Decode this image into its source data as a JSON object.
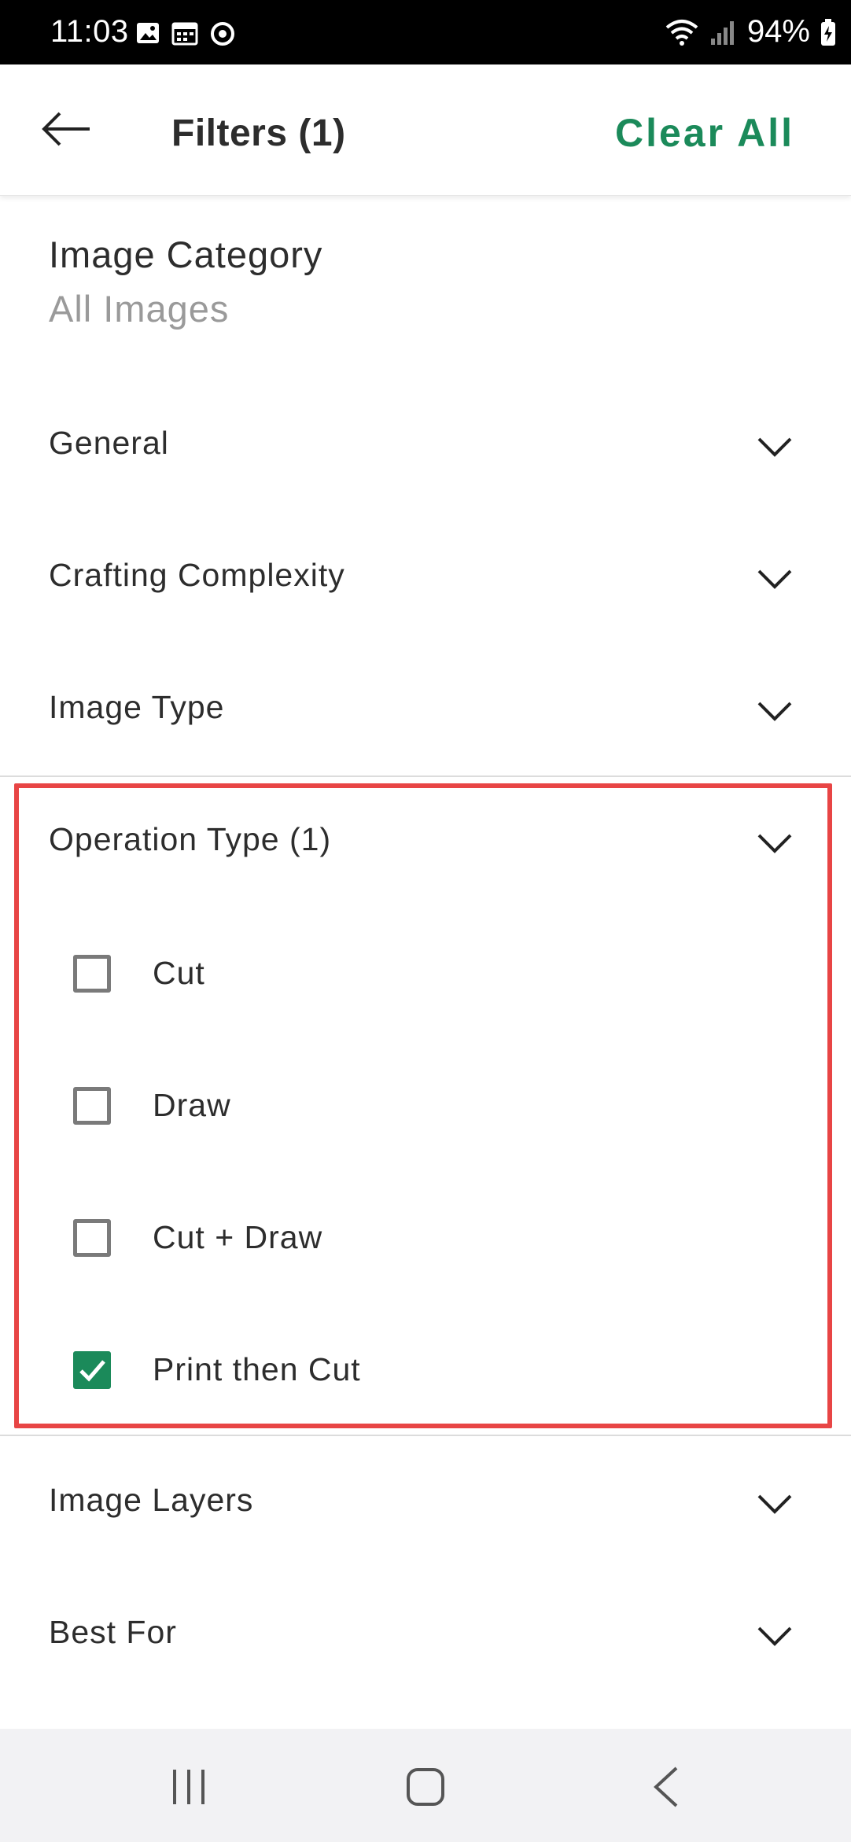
{
  "status_bar": {
    "time": "11:03",
    "battery": "94%",
    "left_icons": [
      "image-icon",
      "calendar-icon",
      "sync-icon"
    ],
    "right_icons": [
      "wifi-icon",
      "signal-icon",
      "battery-charging-icon"
    ]
  },
  "header": {
    "title": "Filters (1)",
    "clear_all": "Clear All",
    "accent_color": "#1b8a5a"
  },
  "image_category": {
    "label": "Image Category",
    "value": "All Images"
  },
  "sections": {
    "general": "General",
    "crafting_complexity": "Crafting Complexity",
    "image_type": "Image Type",
    "operation_type": "Operation Type (1)",
    "image_layers": "Image Layers",
    "best_for": "Best For"
  },
  "operation_options": [
    {
      "label": "Cut",
      "checked": false
    },
    {
      "label": "Draw",
      "checked": false
    },
    {
      "label": "Cut + Draw",
      "checked": false
    },
    {
      "label": "Print then Cut",
      "checked": true
    }
  ],
  "highlight_color": "#e84545",
  "nav_bar": {
    "buttons": [
      "recent-apps-icon",
      "home-icon",
      "back-icon"
    ]
  }
}
